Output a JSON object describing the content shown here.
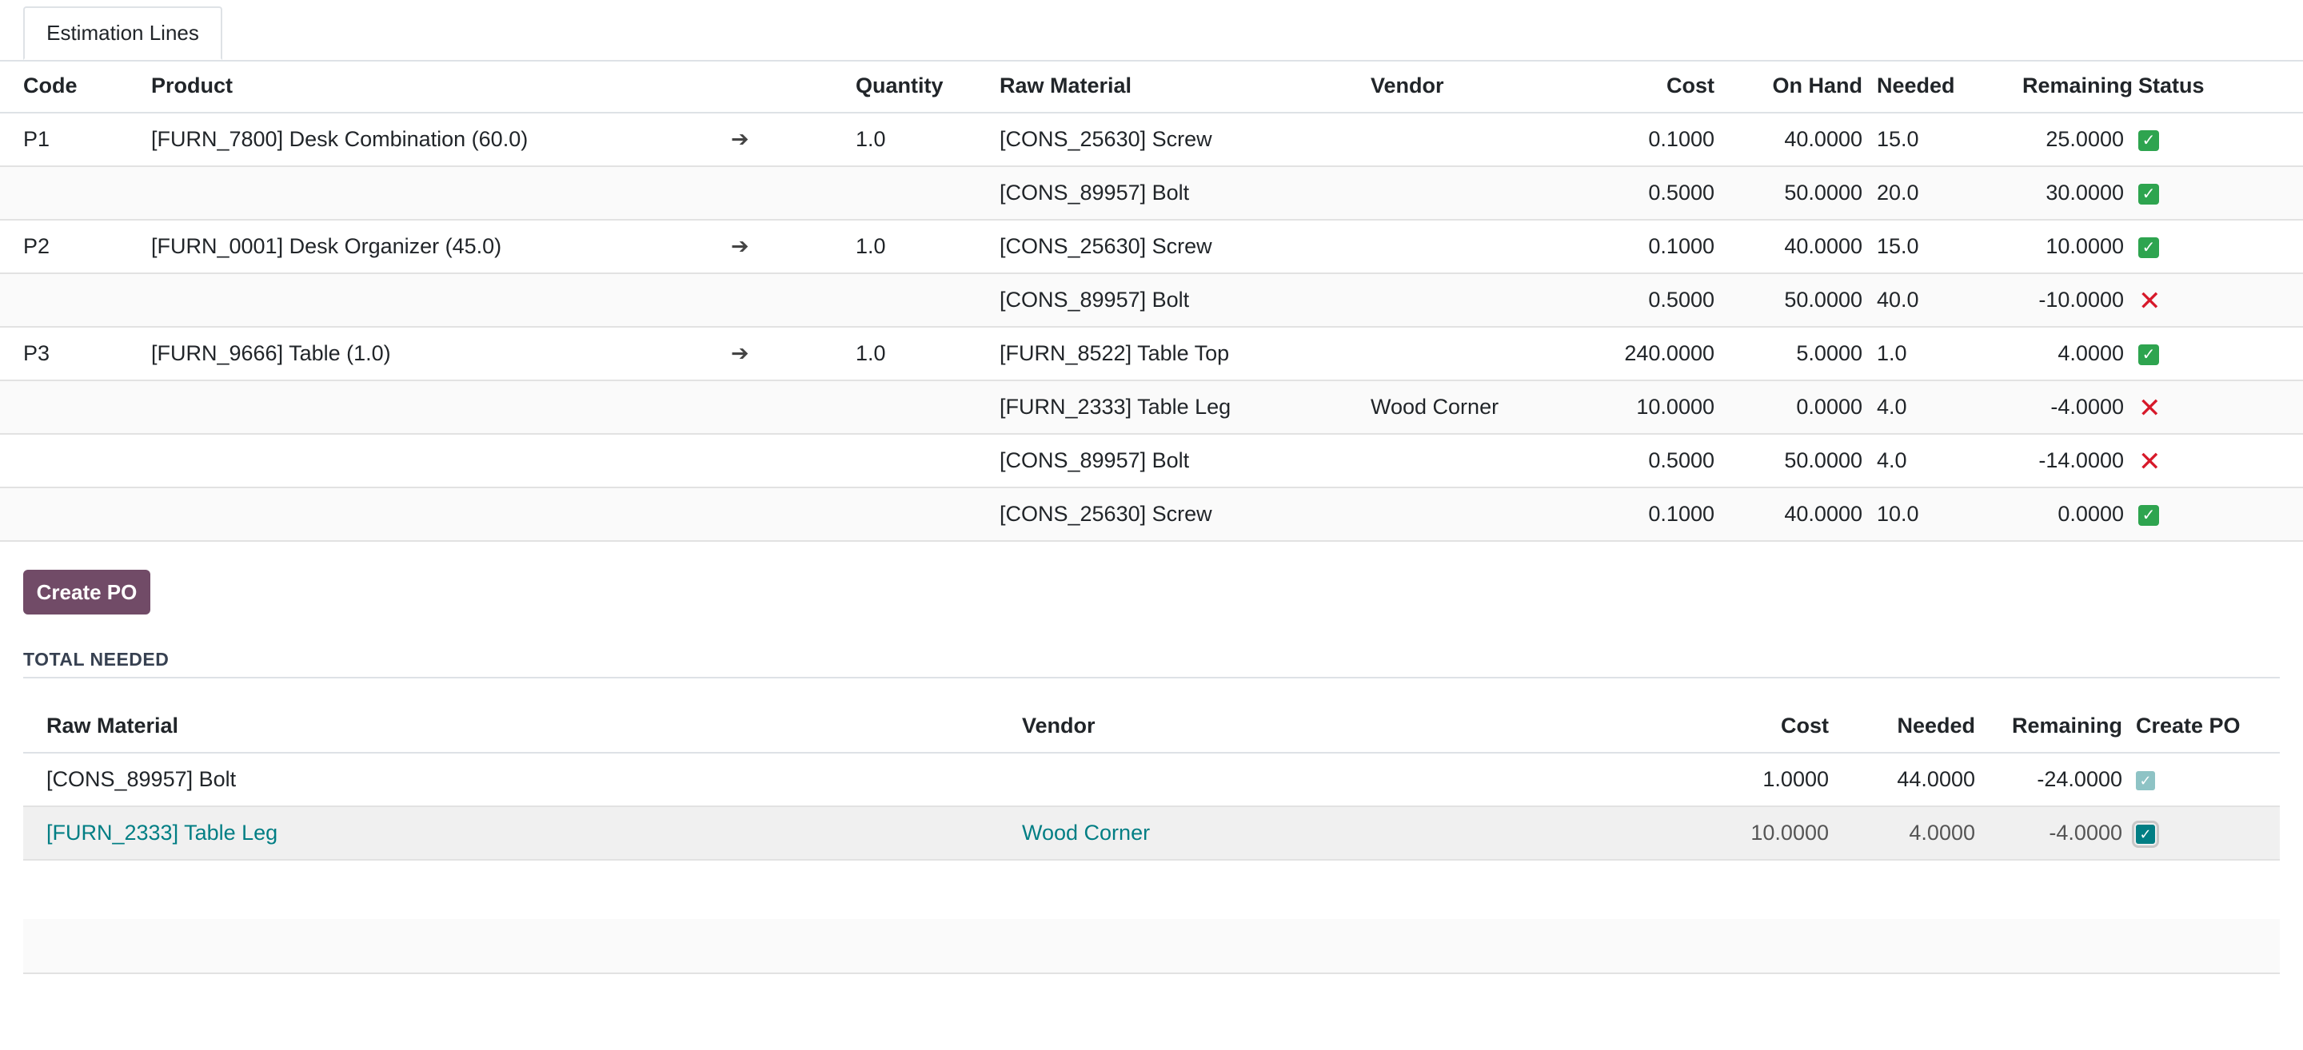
{
  "tabs": [
    {
      "label": "Estimation Lines"
    }
  ],
  "estimation": {
    "headers": {
      "code": "Code",
      "product": "Product",
      "quantity": "Quantity",
      "raw_material": "Raw Material",
      "vendor": "Vendor",
      "cost": "Cost",
      "on_hand": "On Hand",
      "needed": "Needed",
      "remaining": "Remaining",
      "status": "Status"
    },
    "rows": [
      {
        "code": "P1",
        "product": "[FURN_7800] Desk Combination (60.0)",
        "arrow": "➔",
        "quantity": "1.0",
        "raw_material": "[CONS_25630] Screw",
        "vendor": "",
        "cost": "0.1000",
        "on_hand": "40.0000",
        "needed": "15.0",
        "remaining": "25.0000",
        "status": "ok"
      },
      {
        "code": "",
        "product": "",
        "arrow": "",
        "quantity": "",
        "raw_material": "[CONS_89957] Bolt",
        "vendor": "",
        "cost": "0.5000",
        "on_hand": "50.0000",
        "needed": "20.0",
        "remaining": "30.0000",
        "status": "ok"
      },
      {
        "code": "P2",
        "product": "[FURN_0001] Desk Organizer (45.0)",
        "arrow": "➔",
        "quantity": "1.0",
        "raw_material": "[CONS_25630] Screw",
        "vendor": "",
        "cost": "0.1000",
        "on_hand": "40.0000",
        "needed": "15.0",
        "remaining": "10.0000",
        "status": "ok"
      },
      {
        "code": "",
        "product": "",
        "arrow": "",
        "quantity": "",
        "raw_material": "[CONS_89957] Bolt",
        "vendor": "",
        "cost": "0.5000",
        "on_hand": "50.0000",
        "needed": "40.0",
        "remaining": "-10.0000",
        "status": "bad"
      },
      {
        "code": "P3",
        "product": "[FURN_9666] Table (1.0)",
        "arrow": "➔",
        "quantity": "1.0",
        "raw_material": "[FURN_8522] Table Top",
        "vendor": "",
        "cost": "240.0000",
        "on_hand": "5.0000",
        "needed": "1.0",
        "remaining": "4.0000",
        "status": "ok"
      },
      {
        "code": "",
        "product": "",
        "arrow": "",
        "quantity": "",
        "raw_material": "[FURN_2333] Table Leg",
        "vendor": "Wood Corner",
        "cost": "10.0000",
        "on_hand": "0.0000",
        "needed": "4.0",
        "remaining": "-4.0000",
        "status": "bad"
      },
      {
        "code": "",
        "product": "",
        "arrow": "",
        "quantity": "",
        "raw_material": "[CONS_89957] Bolt",
        "vendor": "",
        "cost": "0.5000",
        "on_hand": "50.0000",
        "needed": "4.0",
        "remaining": "-14.0000",
        "status": "bad"
      },
      {
        "code": "",
        "product": "",
        "arrow": "",
        "quantity": "",
        "raw_material": "[CONS_25630] Screw",
        "vendor": "",
        "cost": "0.1000",
        "on_hand": "40.0000",
        "needed": "10.0",
        "remaining": "0.0000",
        "status": "ok"
      }
    ]
  },
  "actions": {
    "create_po": "Create PO"
  },
  "totals": {
    "title": "TOTAL NEEDED",
    "headers": {
      "raw_material": "Raw Material",
      "vendor": "Vendor",
      "cost": "Cost",
      "needed": "Needed",
      "remaining": "Remaining",
      "create_po": "Create PO"
    },
    "rows": [
      {
        "raw_material": "[CONS_89957] Bolt",
        "vendor": "",
        "cost": "1.0000",
        "needed": "44.0000",
        "remaining": "-24.0000",
        "create_po": true,
        "selected": false
      },
      {
        "raw_material": "[FURN_2333] Table Leg",
        "vendor": "Wood Corner",
        "cost": "10.0000",
        "needed": "4.0000",
        "remaining": "-4.0000",
        "create_po": true,
        "selected": true
      }
    ]
  },
  "icons": {
    "status_ok": "check-mark-icon",
    "status_bad": "cross-mark-icon",
    "arrow": "arrow-right-icon"
  },
  "colors": {
    "primary_button": "#714b67",
    "link": "#017e84",
    "ok": "#2ea44f",
    "bad": "#d7192a"
  }
}
